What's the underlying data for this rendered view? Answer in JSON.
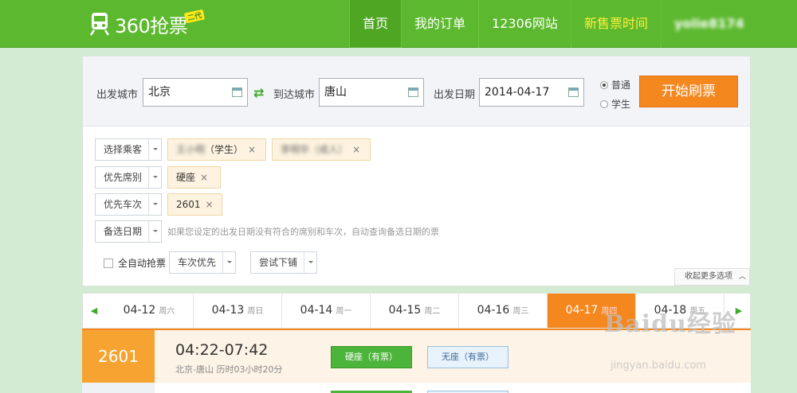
{
  "header": {
    "logo_text": "360抢票",
    "logo_badge": "二代",
    "nav": [
      "首页",
      "我的订单",
      "12306网站",
      "新售票时间"
    ],
    "username": "yolie8174"
  },
  "search": {
    "from_label": "出发城市",
    "from_value": "北京",
    "to_label": "到达城市",
    "to_value": "唐山",
    "date_label": "出发日期",
    "date_value": "2014-04-17",
    "radio_normal": "普通",
    "radio_student": "学生",
    "start_button": "开始刷票"
  },
  "filters": {
    "passenger_dd": "选择乘客",
    "passenger_tags": [
      {
        "name": "王小明",
        "note": "（学生）"
      },
      {
        "name": "李明华",
        "note": "（成人）"
      }
    ],
    "seat_dd": "优先席别",
    "seat_tag": "硬座",
    "train_dd": "优先车次",
    "train_tag": "2601",
    "date_dd": "备选日期",
    "date_hint": "如果您设定的出发日期没有符合的席别和车次，自动查询备选日期的票",
    "auto_label": "全自动抢票",
    "priority_dd": "车次优先",
    "berth_dd": "尝试下铺",
    "collapse": "收起更多选项"
  },
  "dates": [
    {
      "date": "04-12",
      "weekday": "周六"
    },
    {
      "date": "04-13",
      "weekday": "周日"
    },
    {
      "date": "04-14",
      "weekday": "周一"
    },
    {
      "date": "04-15",
      "weekday": "周二"
    },
    {
      "date": "04-16",
      "weekday": "周三"
    },
    {
      "date": "04-17",
      "weekday": "周四"
    },
    {
      "date": "04-18",
      "weekday": "周五"
    }
  ],
  "train": {
    "number": "2601",
    "time": "04:22-07:42",
    "route": "北京-唐山 历时03小时20分",
    "seat1": "硬座（有票）",
    "seat2": "无座（有票）"
  },
  "watermark": {
    "text": "Baidu经验",
    "url": "jingyan.baidu.com"
  }
}
